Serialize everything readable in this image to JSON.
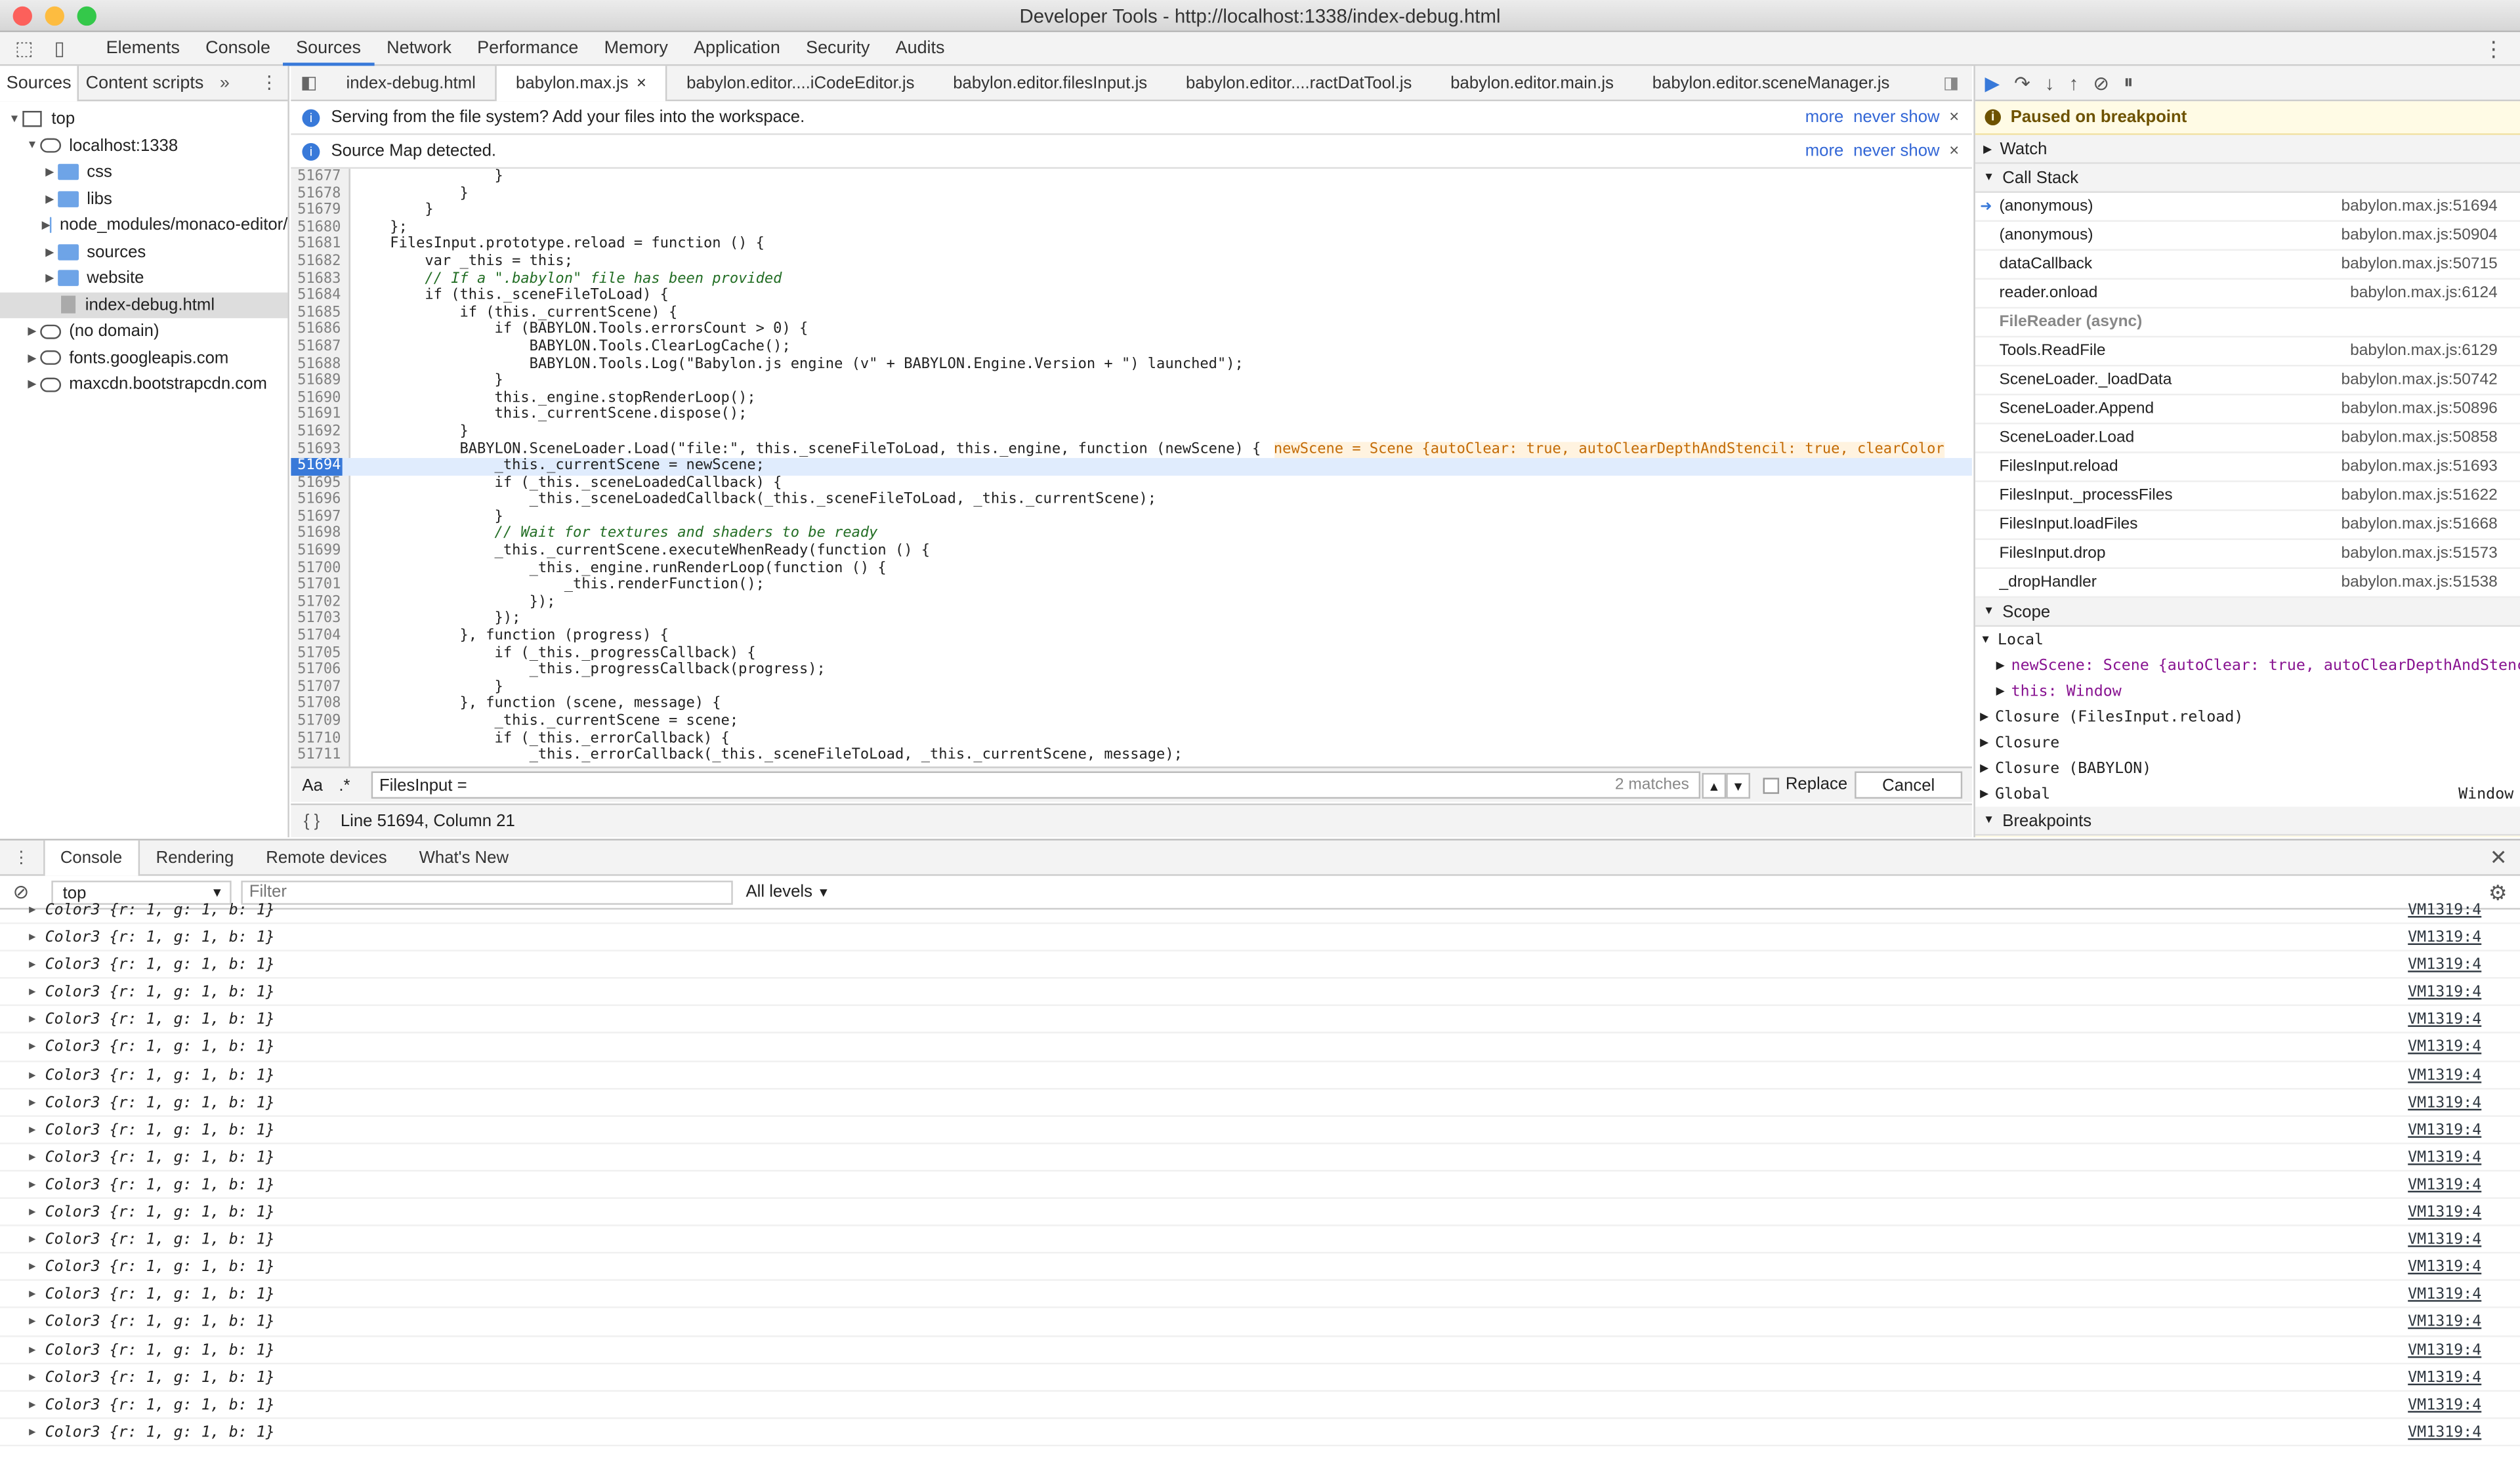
{
  "window": {
    "title": "Developer Tools - http://localhost:1338/index-debug.html"
  },
  "main_tabs": [
    "Elements",
    "Console",
    "Sources",
    "Network",
    "Performance",
    "Memory",
    "Application",
    "Security",
    "Audits"
  ],
  "sidebar": {
    "tabs": [
      "Sources",
      "Content scripts"
    ],
    "tree": [
      {
        "label": "top",
        "kind": "frame",
        "indent": 0,
        "tri": "▼"
      },
      {
        "label": "localhost:1338",
        "kind": "cloud",
        "indent": 1,
        "tri": "▼"
      },
      {
        "label": "css",
        "kind": "folder",
        "indent": 2,
        "tri": "▶"
      },
      {
        "label": "libs",
        "kind": "folder",
        "indent": 2,
        "tri": "▶"
      },
      {
        "label": "node_modules/monaco-editor/",
        "kind": "folder",
        "indent": 2,
        "tri": "▶"
      },
      {
        "label": "sources",
        "kind": "folder",
        "indent": 2,
        "tri": "▶"
      },
      {
        "label": "website",
        "kind": "folder",
        "indent": 2,
        "tri": "▶"
      },
      {
        "label": "index-debug.html",
        "kind": "file",
        "indent": 2,
        "tri": "",
        "selected": true
      },
      {
        "label": "(no domain)",
        "kind": "cloud",
        "indent": 1,
        "tri": "▶"
      },
      {
        "label": "fonts.googleapis.com",
        "kind": "cloud",
        "indent": 1,
        "tri": "▶"
      },
      {
        "label": "maxcdn.bootstrapcdn.com",
        "kind": "cloud",
        "indent": 1,
        "tri": "▶"
      }
    ]
  },
  "editor": {
    "file_tabs": [
      "index-debug.html",
      "babylon.max.js",
      "babylon.editor....iCodeEditor.js",
      "babylon.editor.filesInput.js",
      "babylon.editor....ractDatTool.js",
      "babylon.editor.main.js",
      "babylon.editor.sceneManager.js"
    ],
    "close_glyph": "×",
    "info_bars": [
      {
        "text": "Serving from the file system? Add your files into the workspace.",
        "more": "more",
        "never": "never show"
      },
      {
        "text": "Source Map detected.",
        "more": "more",
        "never": "never show"
      }
    ],
    "lines": [
      {
        "n": "51677",
        "code": "                }"
      },
      {
        "n": "51678",
        "code": "            }"
      },
      {
        "n": "51679",
        "code": "        }"
      },
      {
        "n": "51680",
        "code": "    };"
      },
      {
        "n": "51681",
        "code": "    FilesInput.prototype.reload = function () {"
      },
      {
        "n": "51682",
        "code": "        var _this = this;"
      },
      {
        "n": "51683",
        "code": "        // If a \".babylon\" file has been provided",
        "cls": "cmt"
      },
      {
        "n": "51684",
        "code": "        if (this._sceneFileToLoad) {"
      },
      {
        "n": "51685",
        "code": "            if (this._currentScene) {"
      },
      {
        "n": "51686",
        "code": "                if (BABYLON.Tools.errorsCount > 0) {"
      },
      {
        "n": "51687",
        "code": "                    BABYLON.Tools.ClearLogCache();"
      },
      {
        "n": "51688",
        "code": "                    BABYLON.Tools.Log(\"Babylon.js engine (v\" + BABYLON.Engine.Version + \") launched\");"
      },
      {
        "n": "51689",
        "code": "                }"
      },
      {
        "n": "51690",
        "code": "                this._engine.stopRenderLoop();"
      },
      {
        "n": "51691",
        "code": "                this._currentScene.dispose();"
      },
      {
        "n": "51692",
        "code": "            }"
      },
      {
        "n": "51693",
        "code": "            BABYLON.SceneLoader.Load(\"file:\", this._sceneFileToLoad, this._engine, function (newScene) {",
        "inline": "newScene = Scene {autoClear: true, autoClearDepthAndStencil: true, clearColor"
      },
      {
        "n": "51694",
        "code": "                _this._currentScene = newScene;",
        "exec": true
      },
      {
        "n": "51695",
        "code": "                if (_this._sceneLoadedCallback) {"
      },
      {
        "n": "51696",
        "code": "                    _this._sceneLoadedCallback(_this._sceneFileToLoad, _this._currentScene);"
      },
      {
        "n": "51697",
        "code": "                }"
      },
      {
        "n": "51698",
        "code": "                // Wait for textures and shaders to be ready",
        "cls": "cmt"
      },
      {
        "n": "51699",
        "code": "                _this._currentScene.executeWhenReady(function () {"
      },
      {
        "n": "51700",
        "code": "                    _this._engine.runRenderLoop(function () {"
      },
      {
        "n": "51701",
        "code": "                        _this.renderFunction();"
      },
      {
        "n": "51702",
        "code": "                    });"
      },
      {
        "n": "51703",
        "code": "                });"
      },
      {
        "n": "51704",
        "code": "            }, function (progress) {"
      },
      {
        "n": "51705",
        "code": "                if (_this._progressCallback) {"
      },
      {
        "n": "51706",
        "code": "                    _this._progressCallback(progress);"
      },
      {
        "n": "51707",
        "code": "                }"
      },
      {
        "n": "51708",
        "code": "            }, function (scene, message) {"
      },
      {
        "n": "51709",
        "code": "                _this._currentScene = scene;"
      },
      {
        "n": "51710",
        "code": "                if (_this._errorCallback) {"
      },
      {
        "n": "51711",
        "code": "                    _this._errorCallback(_this._sceneFileToLoad, _this._currentScene, message);"
      }
    ],
    "search": {
      "case_label": "Aa",
      "regex_label": ".*",
      "value": "FilesInput =",
      "matches": "2 matches",
      "replace_label": "Replace",
      "cancel_label": "Cancel"
    },
    "status": {
      "braces": "{ }",
      "position": "Line 51694, Column 21"
    }
  },
  "debugger": {
    "paused": "Paused on breakpoint",
    "watch": "Watch",
    "call_stack_title": "Call Stack",
    "call_stack": [
      {
        "fn": "(anonymous)",
        "loc": "babylon.max.js:51694",
        "current": true
      },
      {
        "fn": "(anonymous)",
        "loc": "babylon.max.js:50904"
      },
      {
        "fn": "dataCallback",
        "loc": "babylon.max.js:50715"
      },
      {
        "fn": "reader.onload",
        "loc": "babylon.max.js:6124"
      },
      {
        "fn": "FileReader (async)",
        "loc": "",
        "async": true
      },
      {
        "fn": "Tools.ReadFile",
        "loc": "babylon.max.js:6129"
      },
      {
        "fn": "SceneLoader._loadData",
        "loc": "babylon.max.js:50742"
      },
      {
        "fn": "SceneLoader.Append",
        "loc": "babylon.max.js:50896"
      },
      {
        "fn": "SceneLoader.Load",
        "loc": "babylon.max.js:50858"
      },
      {
        "fn": "FilesInput.reload",
        "loc": "babylon.max.js:51693"
      },
      {
        "fn": "FilesInput._processFiles",
        "loc": "babylon.max.js:51622"
      },
      {
        "fn": "FilesInput.loadFiles",
        "loc": "babylon.max.js:51668"
      },
      {
        "fn": "FilesInput.drop",
        "loc": "babylon.max.js:51573"
      },
      {
        "fn": "_dropHandler",
        "loc": "babylon.max.js:51538"
      }
    ],
    "scope_title": "Scope",
    "scope": [
      {
        "text": "Local",
        "tri": "▼",
        "indent": 0
      },
      {
        "text": "newScene: Scene {autoClear: true, autoClearDepthAndStencil:",
        "tri": "▶",
        "indent": 1
      },
      {
        "text": "this: Window",
        "tri": "▶",
        "indent": 1
      },
      {
        "text": "Closure (FilesInput.reload)",
        "tri": "▶",
        "indent": 0
      },
      {
        "text": "Closure",
        "tri": "▶",
        "indent": 0
      },
      {
        "text": "Closure (BABYLON)",
        "tri": "▶",
        "indent": 0
      },
      {
        "text": "Global",
        "tri": "▶",
        "indent": 0,
        "right": "Window"
      }
    ],
    "breakpoints_title": "Breakpoints"
  },
  "console": {
    "tabs": [
      "Console",
      "Rendering",
      "Remote devices",
      "What's New"
    ],
    "context": "top",
    "filter_placeholder": "Filter",
    "levels": "All levels",
    "rows_text": "Color3 {r: 1, g: 1, b: 1}",
    "rows_source": "VM1319:4",
    "row_count": 20
  }
}
